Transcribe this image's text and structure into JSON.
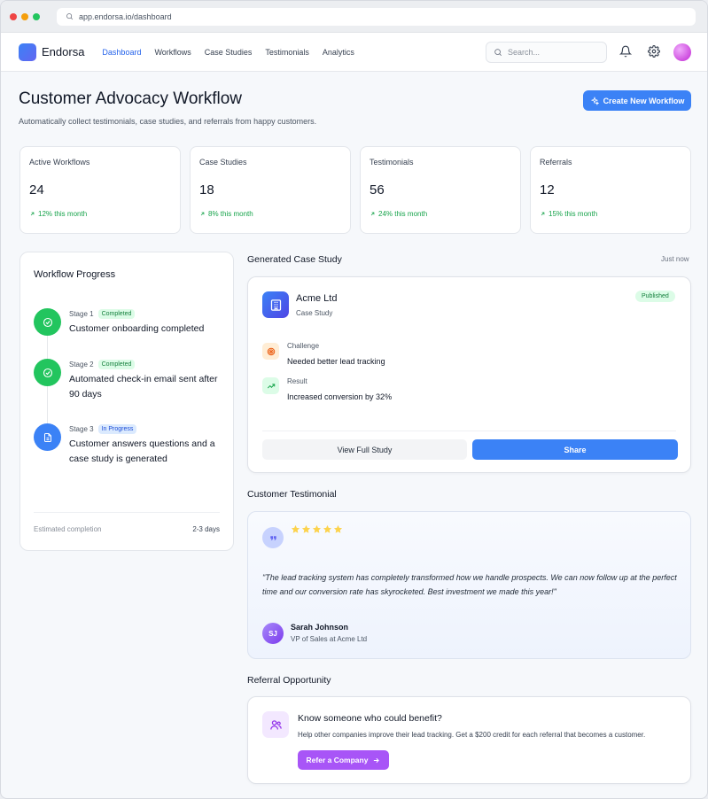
{
  "browser": {
    "url": "app.endorsa.io/dashboard"
  },
  "nav": {
    "brand": "Endorsa",
    "links": [
      "Dashboard",
      "Workflows",
      "Case Studies",
      "Testimonials",
      "Analytics"
    ],
    "active": "Dashboard",
    "search_placeholder": "Search..."
  },
  "header": {
    "title": "Customer Advocacy Workflow",
    "subtitle": "Automatically collect testimonials, case studies, and referrals from happy customers.",
    "create_button": "Create New Workflow"
  },
  "stats": [
    {
      "label": "Active Workflows",
      "value": "24",
      "change": "12% this month"
    },
    {
      "label": "Case Studies",
      "value": "18",
      "change": "8% this month"
    },
    {
      "label": "Testimonials",
      "value": "56",
      "change": "24% this month"
    },
    {
      "label": "Referrals",
      "value": "12",
      "change": "15% this month"
    }
  ],
  "workflow": {
    "title": "Workflow Progress",
    "stages": [
      {
        "stage": "Stage 1",
        "status": "Completed",
        "desc": "Customer onboarding completed"
      },
      {
        "stage": "Stage 2",
        "status": "Completed",
        "desc": "Automated check-in email sent after 90 days"
      },
      {
        "stage": "Stage 3",
        "status": "In Progress",
        "desc": "Customer answers questions and a case study is generated"
      }
    ],
    "footer_label": "Estimated completion",
    "footer_value": "2-3 days"
  },
  "case_study": {
    "section_title": "Generated Case Study",
    "time": "Just now",
    "company": "Acme Ltd",
    "type": "Case Study",
    "status": "Published",
    "challenge_label": "Challenge",
    "challenge": "Needed better lead tracking",
    "result_label": "Result",
    "result": "Increased conversion by 32%",
    "view_button": "View Full Study",
    "share_button": "Share"
  },
  "testimonial": {
    "section_title": "Customer Testimonial",
    "rating": 5,
    "quote": "\"The lead tracking system has completely transformed how we handle prospects. We can now follow up at the perfect time and our conversion rate has skyrocketed. Best investment we made this year!\"",
    "initials": "SJ",
    "name": "Sarah Johnson",
    "role": "VP of Sales at Acme Ltd"
  },
  "referral": {
    "section_title": "Referral Opportunity",
    "title": "Know someone who could benefit?",
    "desc": "Help other companies improve their lead tracking. Get a $200 credit for each referral that becomes a customer.",
    "button": "Refer a Company"
  },
  "colors": {
    "primary": "#3b82f6",
    "success": "#22c55e",
    "accent": "#a855f7"
  }
}
